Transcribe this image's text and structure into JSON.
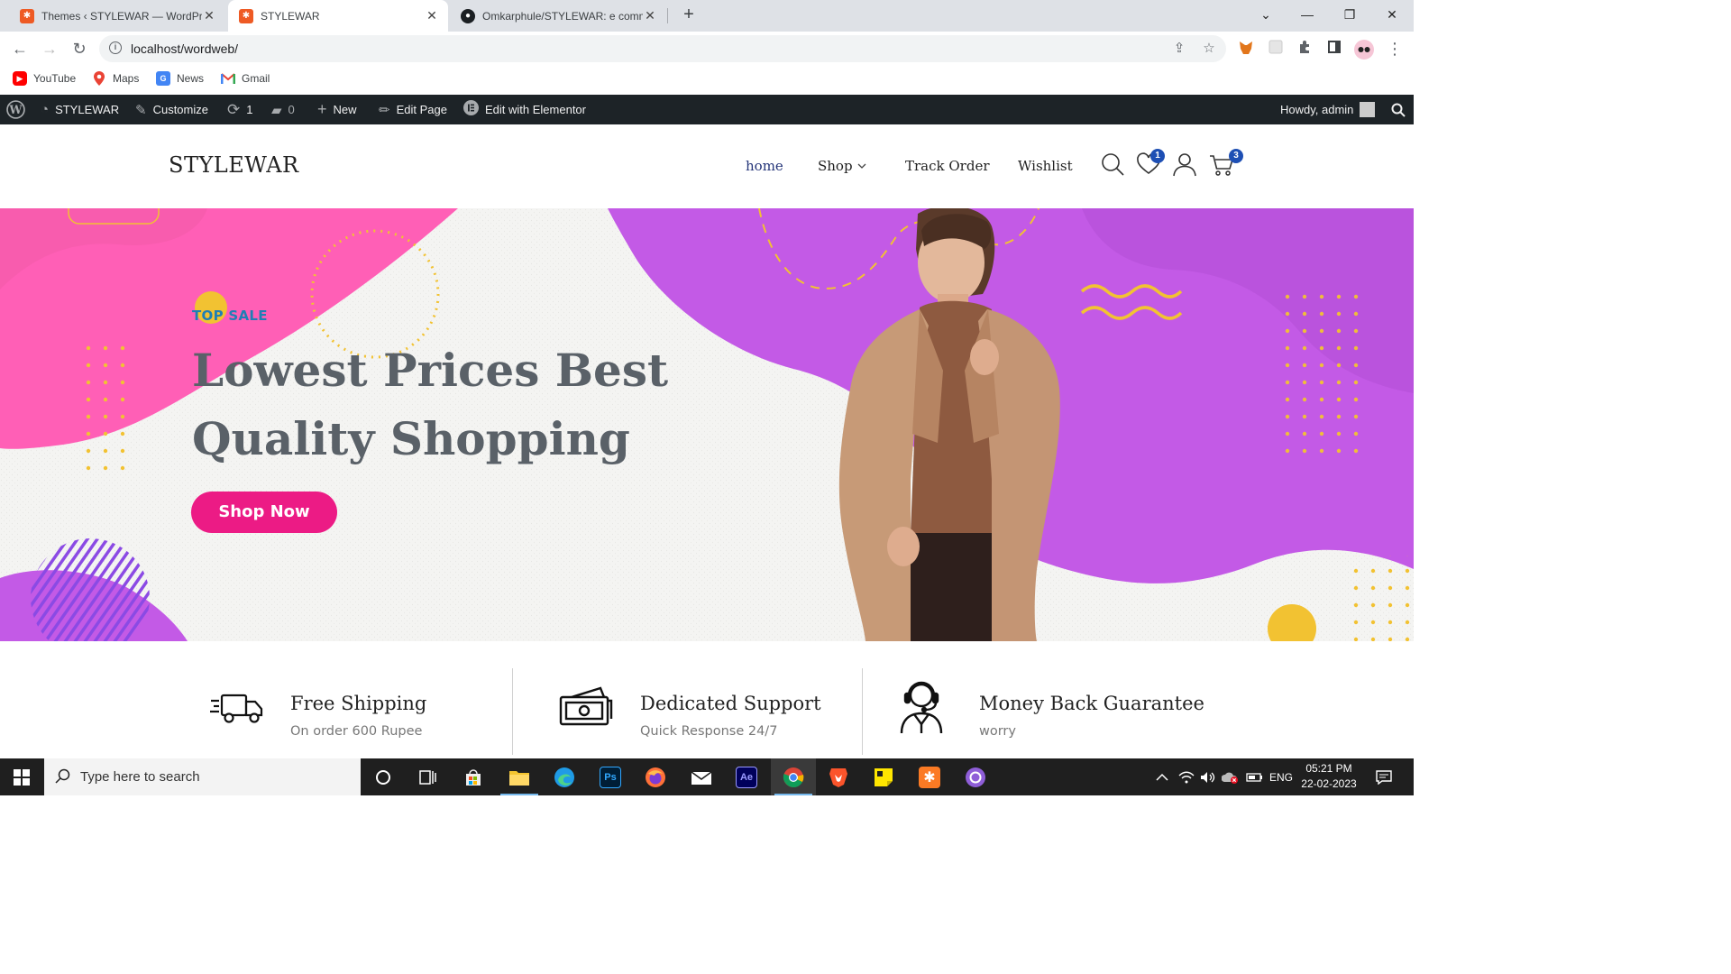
{
  "browser": {
    "tabs": [
      {
        "title": "Themes ‹ STYLEWAR — WordPress",
        "close": "✕",
        "active": false
      },
      {
        "title": "STYLEWAR",
        "close": "✕",
        "active": true
      },
      {
        "title": "Omkarphule/STYLEWAR: e comm",
        "close": "✕",
        "active": false
      }
    ],
    "new_tab": "+",
    "window_controls": {
      "chevron": "⌄",
      "minimize": "—",
      "maximize": "❐",
      "close": "✕"
    },
    "nav": {
      "back": "←",
      "forward": "→",
      "reload": "↻"
    },
    "url": "localhost/wordweb/",
    "omnibox_icons": {
      "share": "⇪",
      "star": "☆"
    },
    "bookmarks": [
      {
        "label": "YouTube",
        "icon": "youtube-icon",
        "color": "#ff0000"
      },
      {
        "label": "Maps",
        "icon": "maps-icon",
        "color": "#34a853"
      },
      {
        "label": "News",
        "icon": "news-icon",
        "color": "#4285f4"
      },
      {
        "label": "Gmail",
        "icon": "gmail-icon",
        "color": "#ea4335"
      }
    ]
  },
  "adminbar": {
    "site": "STYLEWAR",
    "customize": "Customize",
    "updates": "1",
    "comments": "0",
    "new": "New",
    "edit_page": "Edit Page",
    "edit_elementor": "Edit with Elementor",
    "howdy": "Howdy, admin"
  },
  "site": {
    "logo": "STYLEWAR",
    "nav": [
      {
        "label": "home",
        "current": true
      },
      {
        "label": "Shop",
        "dropdown": true
      },
      {
        "label": "Track Order"
      },
      {
        "label": "Wishlist"
      }
    ],
    "wishlist_count": "1",
    "cart_count": "3"
  },
  "hero": {
    "eyebrow": "TOP SALE",
    "title_line1": "Lowest Prices Best",
    "title_line2": "Quality Shopping",
    "cta": "Shop Now",
    "colors": {
      "pink": "#ff5fb6",
      "purple": "#c35ae6",
      "yellow": "#f2c232",
      "cta": "#ec1b85"
    }
  },
  "features": [
    {
      "title": "Free Shipping",
      "subtitle": "On order 600 Rupee",
      "icon": "delivery-truck-icon"
    },
    {
      "title": "Dedicated Support",
      "subtitle": "Quick Response 24/7",
      "icon": "money-bill-icon"
    },
    {
      "title": "Money Back Guarantee",
      "subtitle": "worry",
      "icon": "headset-agent-icon"
    }
  ],
  "taskbar": {
    "search_placeholder": "Type here to search",
    "lang": "ENG",
    "time": "05:21 PM",
    "date": "22-02-2023"
  }
}
